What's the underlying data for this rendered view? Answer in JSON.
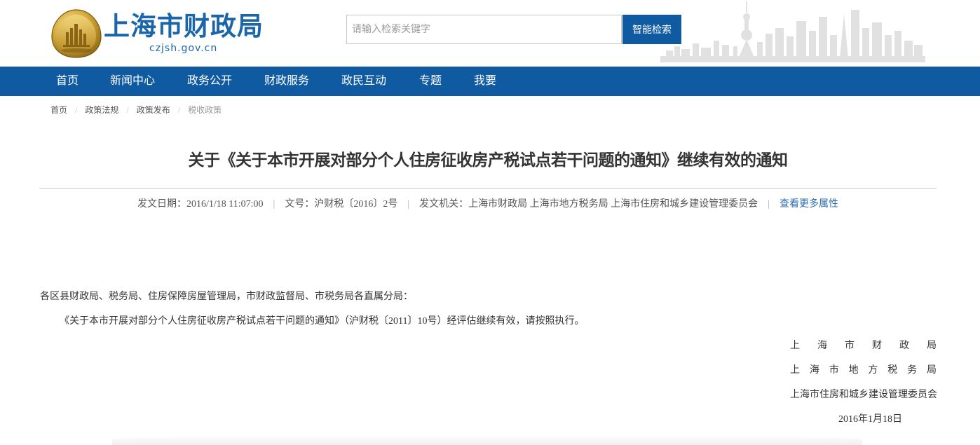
{
  "header": {
    "site_title": "上海市财政局",
    "site_domain": "czjsh.gov.cn",
    "logo_icon": "municipal-emblem-icon",
    "skyline_icon": "shanghai-skyline-icon"
  },
  "search": {
    "placeholder": "请输入检索关键字",
    "value": "",
    "button_label": "智能检索"
  },
  "nav": {
    "items": [
      {
        "label": "首页"
      },
      {
        "label": "新闻中心"
      },
      {
        "label": "政务公开"
      },
      {
        "label": "财政服务"
      },
      {
        "label": "政民互动"
      },
      {
        "label": "专题"
      },
      {
        "label": "我要"
      }
    ]
  },
  "breadcrumb": {
    "items": [
      {
        "label": "首页"
      },
      {
        "label": "政策法规"
      },
      {
        "label": "政策发布"
      },
      {
        "label": "税收政策"
      }
    ]
  },
  "article": {
    "title": "关于《关于本市开展对部分个人住房征收房产税试点若干问题的通知》继续有效的通知",
    "meta": {
      "date_label": "发文日期：",
      "date_value": "2016/1/18 11:07:00",
      "doc_no_label": "文号：",
      "doc_no_value": "沪财税〔2016〕2号",
      "issuer_label": "发文机关：",
      "issuer_value": "上海市财政局 上海市地方税务局 上海市住房和城乡建设管理委员会",
      "more_link": "查看更多属性"
    },
    "salutation": "各区县财政局、税务局、住房保障房屋管理局，市财政监督局、市税务局各直属分局：",
    "paragraph": "《关于本市开展对部分个人住房征收房产税试点若干问题的通知》（沪财税〔2011〕10号）经评估继续有效，请按照执行。",
    "signatures": [
      "上海市财政局",
      "上海市地方税务局",
      "上海市住房和城乡建设管理委员会"
    ],
    "sign_date": "2016年1月18日"
  },
  "colors": {
    "brand_blue": "#0f5aa0",
    "title_blue": "#1a66a8",
    "link_blue": "#2b6cb0"
  }
}
